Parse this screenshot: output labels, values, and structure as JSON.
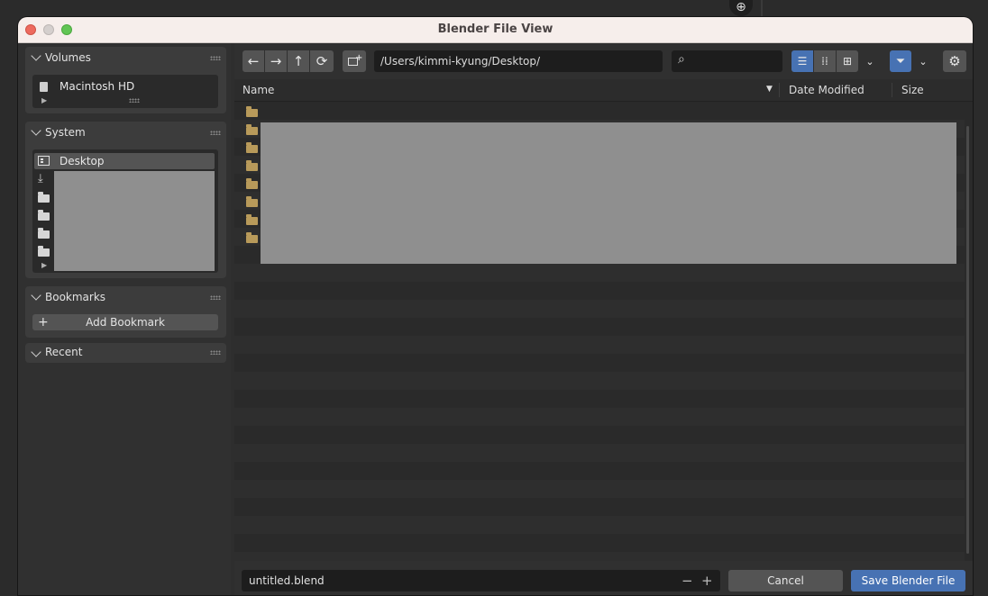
{
  "window": {
    "title": "Blender File View"
  },
  "sidebar": {
    "volumes": {
      "title": "Volumes",
      "items": [
        {
          "label": "Macintosh HD",
          "icon": "disk-icon"
        }
      ]
    },
    "system": {
      "title": "System",
      "items": [
        {
          "label": "Desktop",
          "icon": "desktop-icon",
          "selected": true
        }
      ]
    },
    "bookmarks": {
      "title": "Bookmarks",
      "add_label": "Add Bookmark"
    },
    "recent": {
      "title": "Recent"
    }
  },
  "toolbar": {
    "path": "/Users/kimmi-kyung/Desktop/",
    "search_placeholder": "",
    "icons": [
      "back-arrow-icon",
      "forward-arrow-icon",
      "parent-dir-icon",
      "refresh-icon",
      "new-folder-icon",
      "search-icon",
      "vertical-list-icon",
      "horizontal-list-icon",
      "thumbnails-icon",
      "filter-icon",
      "gear-icon"
    ]
  },
  "columns": {
    "name": "Name",
    "date": "Date Modified",
    "size": "Size"
  },
  "footer": {
    "filename": "untitled.blend",
    "cancel_label": "Cancel",
    "save_label": "Save Blender File"
  },
  "colors": {
    "accent": "#4772b3",
    "folder": "#b89a5a",
    "titlebar": "#f6eeeb"
  }
}
